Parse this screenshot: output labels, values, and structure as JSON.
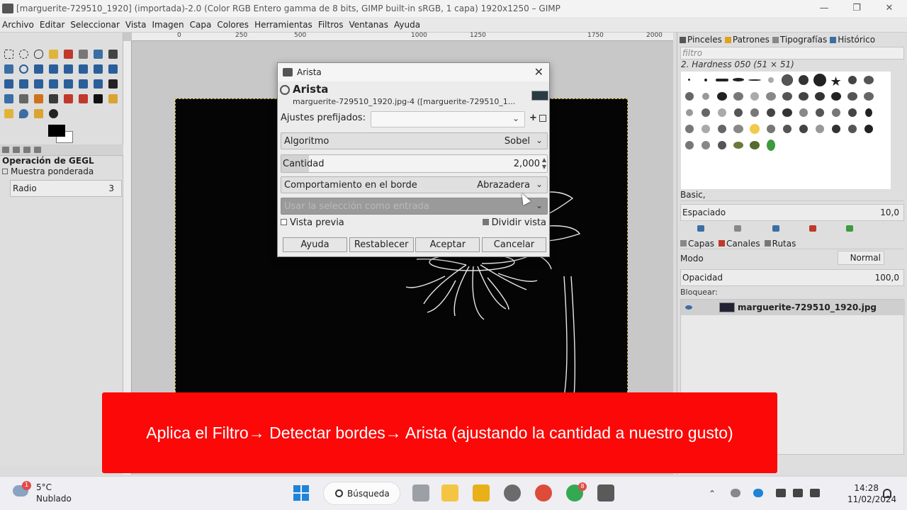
{
  "window": {
    "title": "[marguerite-729510_1920] (importada)-2.0 (Color RGB Entero gamma de 8 bits, GIMP built-in sRGB, 1 capa) 1920x1250 – GIMP",
    "min": "—",
    "max": "❐",
    "close": "✕"
  },
  "menu": [
    "Archivo",
    "Editar",
    "Seleccionar",
    "Vista",
    "Imagen",
    "Capa",
    "Colores",
    "Herramientas",
    "Filtros",
    "Ventanas",
    "Ayuda"
  ],
  "toolbox": {
    "gegl_title": "Operación de GEGL",
    "sample_label": "Muestra ponderada",
    "radius_label": "Radio",
    "radius_value": "3"
  },
  "ruler": {
    "marks": [
      "0",
      "250",
      "500",
      "1000",
      "1250",
      "1750",
      "2000"
    ]
  },
  "dialog": {
    "window_title": "Arista",
    "close": "✕",
    "header_title": "Arista",
    "header_sub": "marguerite-729510_1920.jpg-4 ([marguerite-729510_1...",
    "presets_label": "Ajustes prefijados:",
    "presets_add": "+",
    "algorithm_label": "Algoritmo",
    "algorithm_value": "Sobel",
    "amount_label": "Cantidad",
    "amount_value": "2,000",
    "border_label": "Comportamiento en el borde",
    "border_value": "Abrazadera",
    "selection_label": "Usar la selección como entrada",
    "preview_label": "Vista previa",
    "split_label": "Dividir vista",
    "buttons": {
      "help": "Ayuda",
      "reset": "Restablecer",
      "ok": "Aceptar",
      "cancel": "Cancelar"
    }
  },
  "right_panel": {
    "tabs": [
      "Pinceles",
      "Patrones",
      "Tipografías",
      "Histórico"
    ],
    "filter_placeholder": "filtro",
    "brush_name": "2. Hardness 050 (51 × 51)",
    "basic_label": "Basic,",
    "spacing_label": "Espaciado",
    "spacing_value": "10,0",
    "layer_tabs": [
      "Capas",
      "Canales",
      "Rutas"
    ],
    "mode_label": "Modo",
    "mode_value": "Normal",
    "opacity_label": "Opacidad",
    "opacity_value": "100,0",
    "lock_label": "Bloquear:",
    "layer_name": "marguerite-729510_1920.jpg"
  },
  "banner": {
    "text": "Aplica el Filtro→ Detectar bordes→ Arista (ajustando la cantidad a nuestro gusto)",
    "color": "#fc0808"
  },
  "taskbar": {
    "weather_badge": "1",
    "temperature": "5°C",
    "condition": "Nublado",
    "search": "Búsqueda",
    "chrome_badge": "8",
    "time": "14:28",
    "date": "11/02/2024"
  }
}
